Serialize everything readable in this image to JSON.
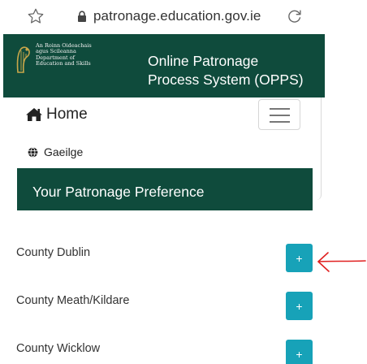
{
  "browser": {
    "url": "patronage.education.gov.ie"
  },
  "header": {
    "dept_lines": [
      "An Roinn Oideachais",
      "agus Scileanna",
      "Department of",
      "Education and Skills"
    ],
    "title_lines": [
      "Online Patronage",
      "Process System (OPPS)"
    ]
  },
  "nav": {
    "home_label": "Home",
    "language_label": "Gaeilge"
  },
  "preference": {
    "title": "Your Patronage Preference"
  },
  "counties": [
    {
      "name": "County Dublin",
      "button": "+"
    },
    {
      "name": "County Meath/Kildare",
      "button": "+"
    },
    {
      "name": "County Wicklow",
      "button": "+"
    }
  ],
  "colors": {
    "brand_green": "#0f4b3c",
    "button_teal": "#17a2b8",
    "annotation_red": "#e02020"
  },
  "icons": {
    "bookmark": "star-icon",
    "secure": "lock-icon",
    "refresh": "reload-icon",
    "home": "home-icon",
    "language": "globe-icon",
    "menu": "hamburger-icon",
    "crest": "harp-icon"
  }
}
